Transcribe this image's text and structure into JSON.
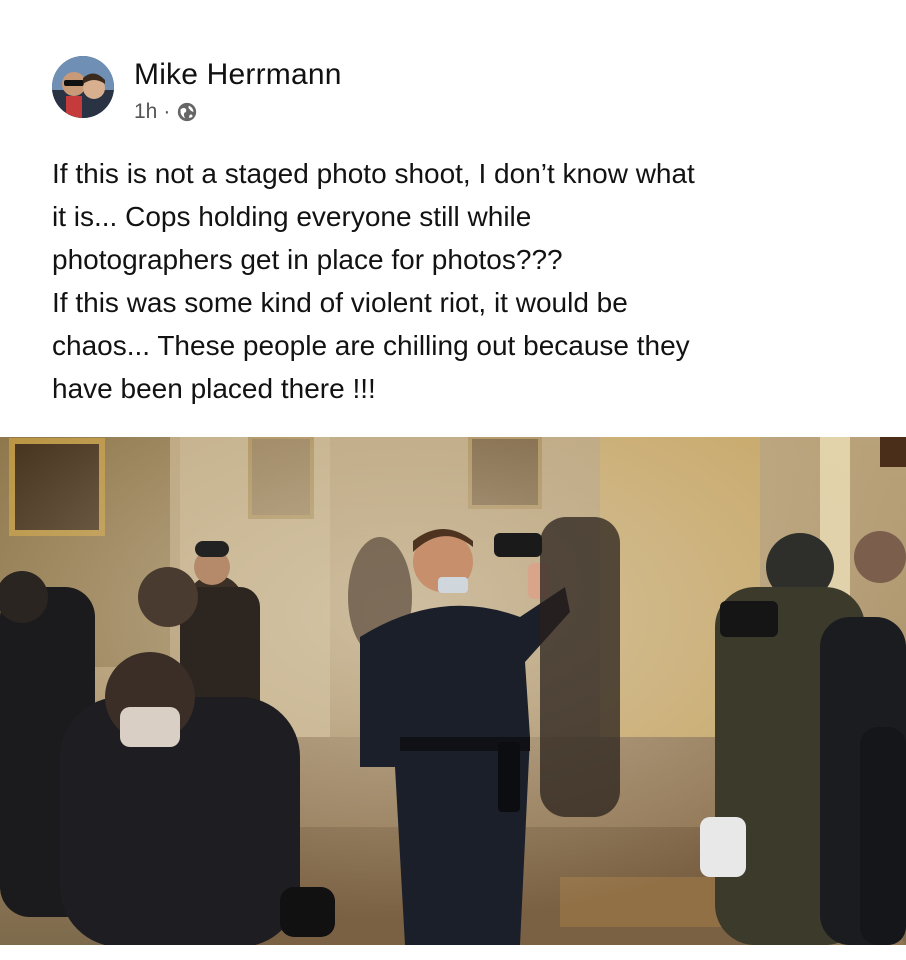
{
  "post": {
    "author": "Mike Herrmann",
    "time": "1h",
    "separator": "·",
    "privacy_icon": "globe-icon",
    "text": "If this is not a staged photo shoot, I don’t know what\nit is... Cops holding everyone still  while\nphotographers get in place for photos???\nIf this was some kind of violent riot, it would be\nchaos... These people are chilling out because they\nhave been placed there !!!"
  },
  "colors": {
    "text": "#121212",
    "meta": "#555555",
    "background": "#ffffff"
  }
}
